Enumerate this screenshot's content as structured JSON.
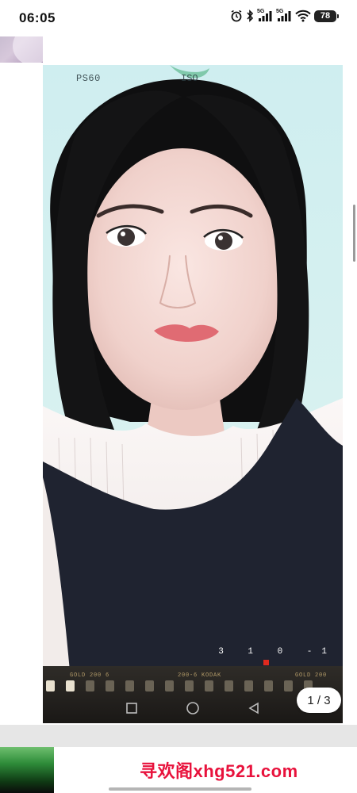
{
  "status_bar": {
    "time": "06:05",
    "signal_1_label": "5G",
    "signal_2_label": "5G",
    "battery": "78",
    "icons": [
      "alarm-icon",
      "bluetooth-icon",
      "signal-icon",
      "signal-icon",
      "wifi-icon",
      "battery-icon"
    ]
  },
  "photo": {
    "overlay_top": "PS60",
    "overlay_iso": "ISO",
    "film_left": "GOLD 200 6",
    "film_mid": "200-6 KODAK",
    "film_right": "GOLD 200",
    "frame_counter": "3 1 0 -1",
    "nav_icons": [
      "square-icon",
      "circle-icon",
      "triangle-back-icon"
    ]
  },
  "viewer": {
    "page_counter": "1 / 3"
  },
  "watermark": {
    "text": "寻欢阁xhg521.com",
    "color": "#e8123c"
  },
  "colors": {
    "background": "#ffffff",
    "photo_sky": "#cfeef0",
    "film_strip": "#1a1816"
  }
}
